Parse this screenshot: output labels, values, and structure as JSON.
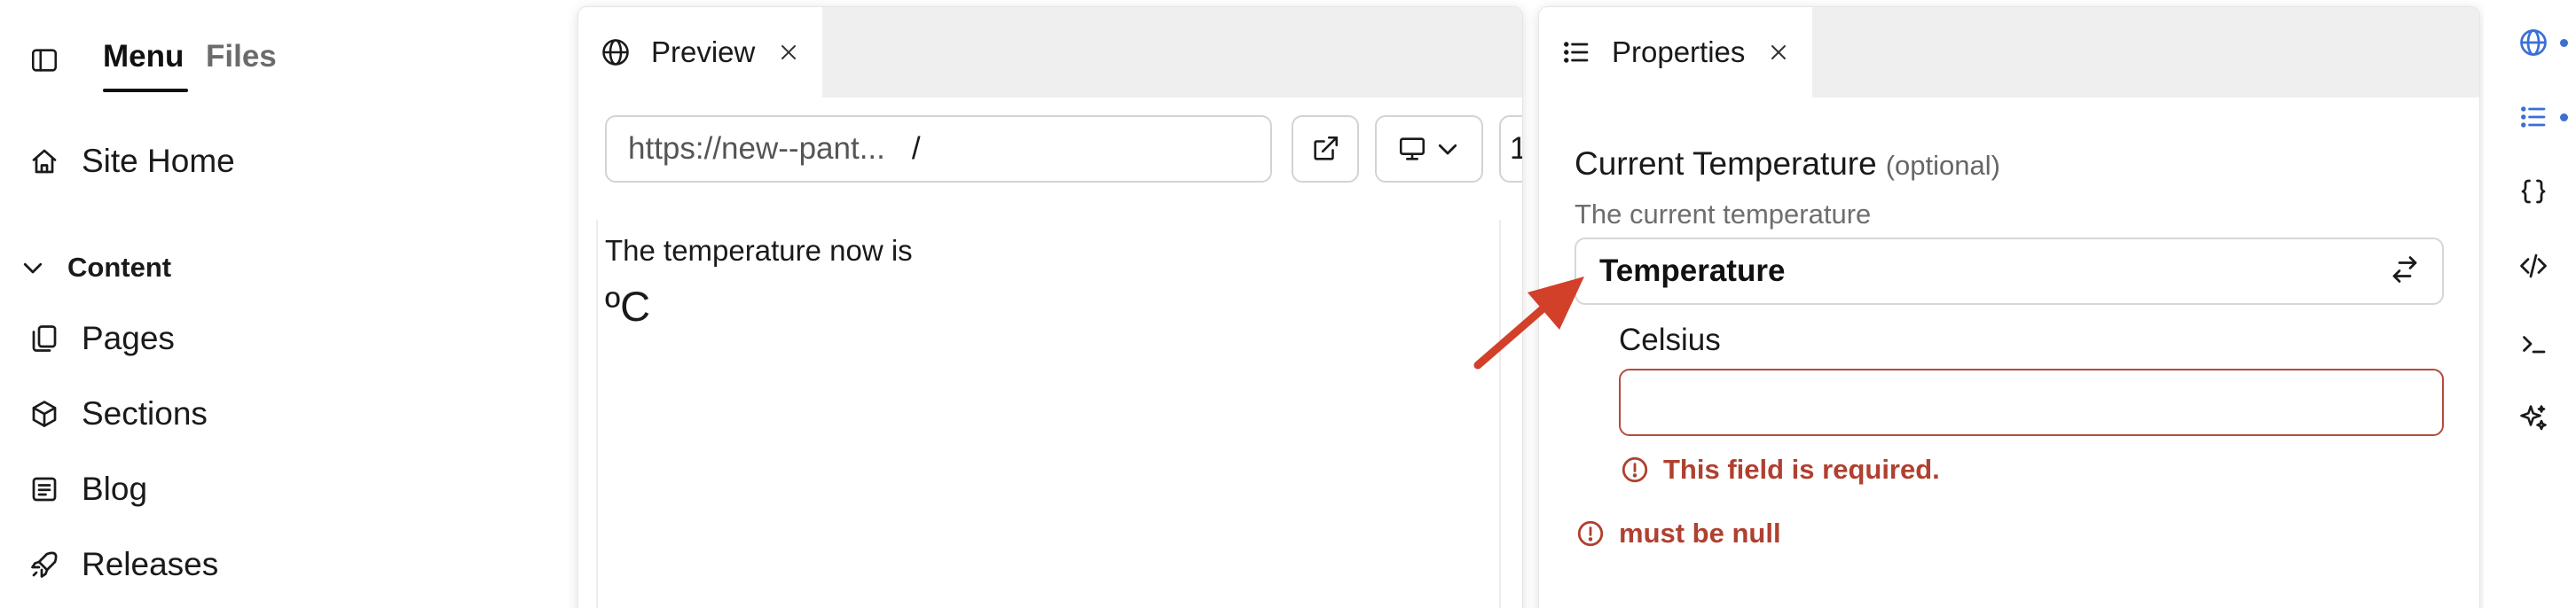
{
  "sidebar": {
    "tabs": {
      "menu": "Menu",
      "files": "Files"
    },
    "site_home": "Site Home",
    "content_section": "Content",
    "items": [
      "Pages",
      "Sections",
      "Blog",
      "Releases"
    ]
  },
  "preview": {
    "tab_label": "Preview",
    "url_host": "https://new--pant...",
    "url_path": "/",
    "more_char": "1",
    "content_text": "The temperature now is",
    "content_unit": "ºC"
  },
  "properties": {
    "tab_label": "Properties",
    "field_title": "Current Temperature",
    "optional_label": "(optional)",
    "field_description": "The current temperature",
    "type_label": "Temperature",
    "sub_field_label": "Celsius",
    "error_required": "This field is required.",
    "error_null": "must be null"
  },
  "colors": {
    "accent": "#3b6fd6",
    "error": "#b0402f",
    "annotation": "#d2402a"
  },
  "rail": {
    "icons": [
      "globe-icon",
      "list-icon",
      "braces-icon",
      "code-icon",
      "terminal-icon",
      "sparkles-icon"
    ]
  }
}
